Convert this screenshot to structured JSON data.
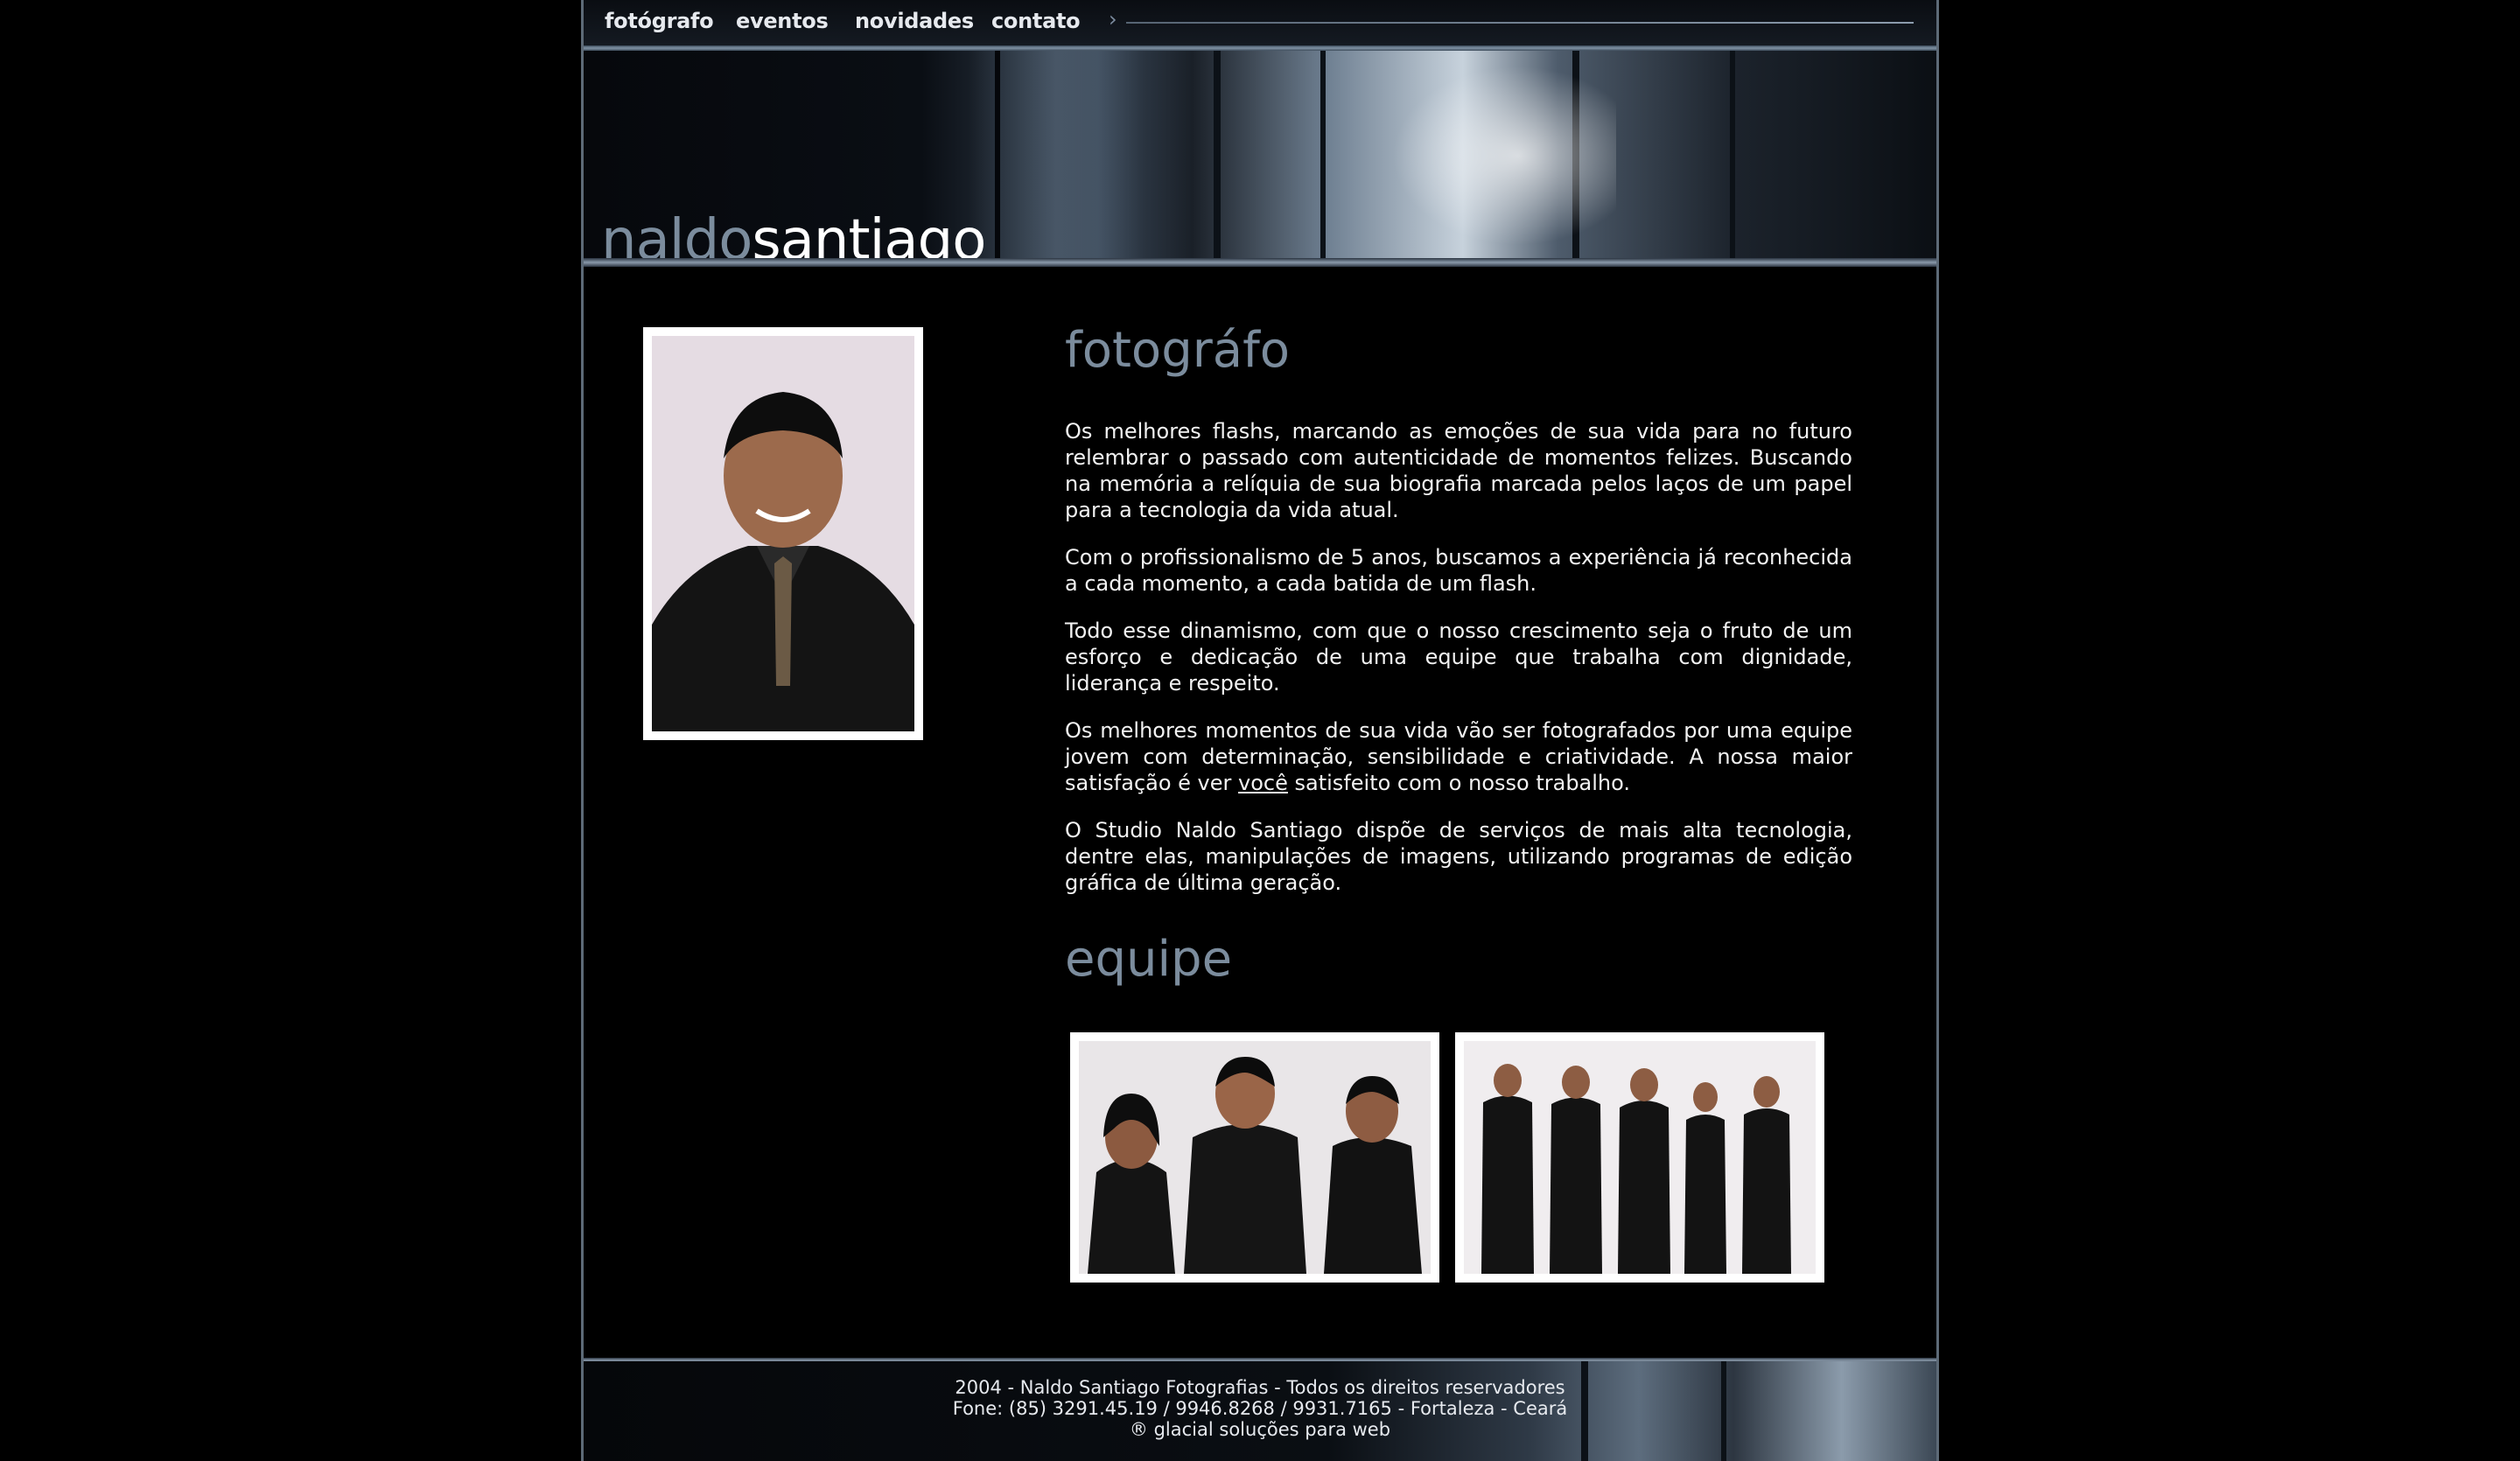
{
  "nav": {
    "items": [
      "fotógrafo",
      "eventos",
      "novidades",
      "contato"
    ]
  },
  "logo": {
    "part1": "naldo",
    "part2": "santiago"
  },
  "section1": {
    "heading": "fotográfo",
    "paragraphs": [
      "Os melhores flashs, marcando as emoções de sua vida para no futuro relembrar o passado com autenticidade de momentos felizes. Buscando na memória a relíquia de sua biografia marcada pelos laços de um papel para a tecnologia da vida atual.",
      "Com o profissionalismo de 5 anos, buscamos a experiência já reconhecida a cada momento, a cada batida de um flash.",
      "Todo esse dinamismo, com que o nosso crescimento seja o fruto de um esforço e dedicação de uma equipe que trabalha com dignidade, liderança e respeito.",
      "O Studio Naldo Santiago dispõe de serviços de mais alta tecnologia, dentre elas, manipulações de imagens, utilizando programas de edição gráfica de última geração."
    ],
    "p4_before": "Os melhores momentos de sua vida vão ser fotografados por uma equipe jovem com determinação, sensibilidade e criatividade. A nossa maior satisfação é ver ",
    "p4_link": "você",
    "p4_after": " satisfeito com o nosso trabalho."
  },
  "section2": {
    "heading": "equipe"
  },
  "footer": {
    "line1": "2004 - Naldo Santiago Fotografias - Todos os direitos reservadores",
    "line2": "Fone: (85) 3291.45.19 / 9946.8268 / 9931.7165 - Fortaleza - Ceará",
    "line3": "® glacial soluções para web"
  },
  "colors": {
    "accent": "#7b8c9d",
    "background": "#000000",
    "border": "#5d6a77"
  }
}
